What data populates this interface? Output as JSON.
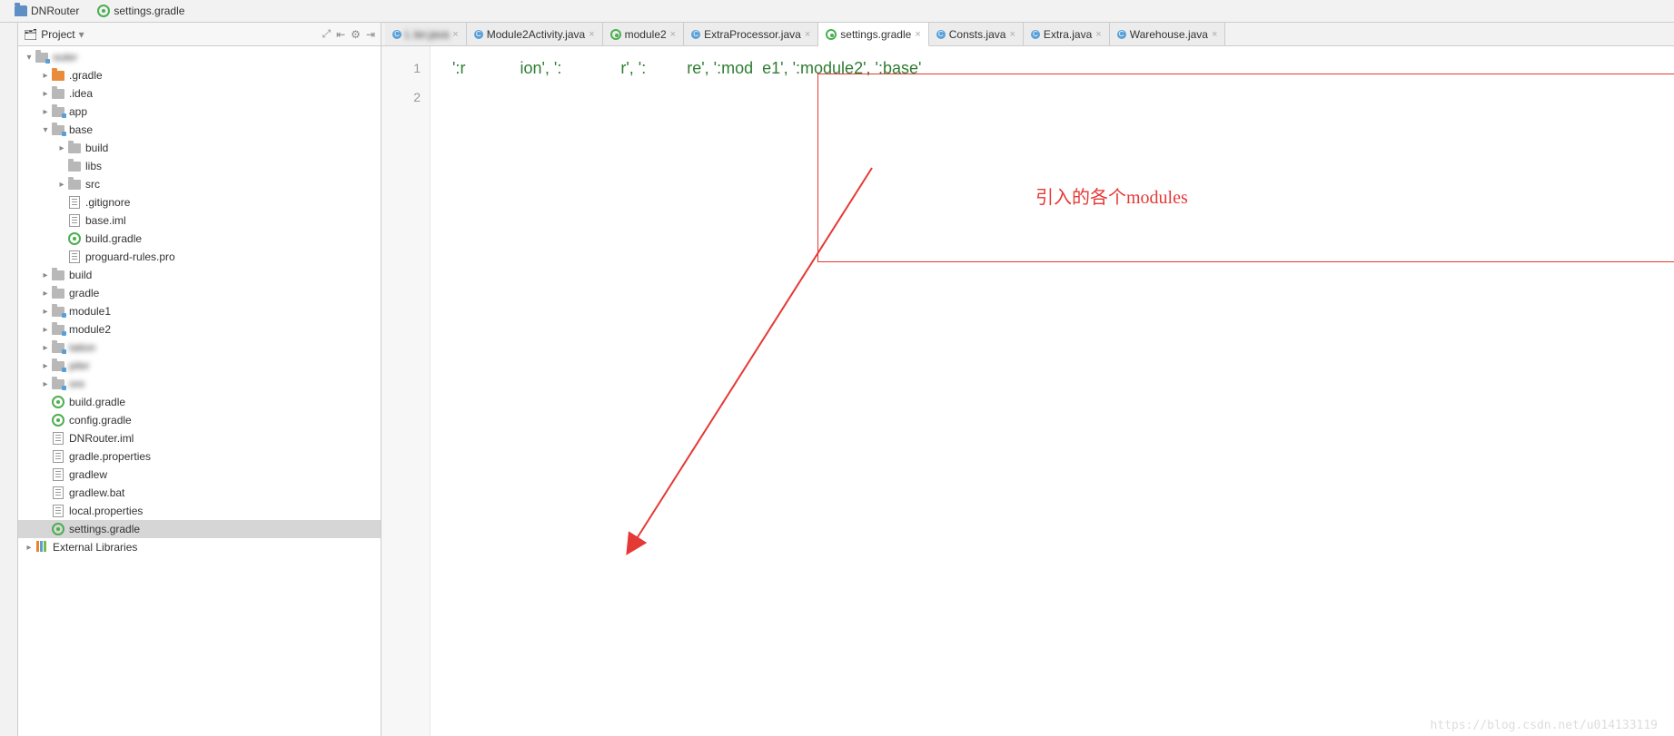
{
  "breadcrumb": {
    "project": "DNRouter",
    "file": "settings.gradle"
  },
  "panel": {
    "title": "Project",
    "tree": [
      {
        "depth": 0,
        "arrow": "down",
        "icon": "module",
        "label": "outer",
        "blur": true
      },
      {
        "depth": 1,
        "arrow": "right",
        "icon": "folder-orange",
        "label": ".gradle"
      },
      {
        "depth": 1,
        "arrow": "right",
        "icon": "folder-grey",
        "label": ".idea"
      },
      {
        "depth": 1,
        "arrow": "right",
        "icon": "module",
        "label": "app"
      },
      {
        "depth": 1,
        "arrow": "down",
        "icon": "module",
        "label": "base"
      },
      {
        "depth": 2,
        "arrow": "right",
        "icon": "folder-grey",
        "label": "build"
      },
      {
        "depth": 2,
        "arrow": "none",
        "icon": "folder-grey",
        "label": "libs"
      },
      {
        "depth": 2,
        "arrow": "right",
        "icon": "folder-grey",
        "label": "src"
      },
      {
        "depth": 2,
        "arrow": "none",
        "icon": "file",
        "label": ".gitignore"
      },
      {
        "depth": 2,
        "arrow": "none",
        "icon": "file",
        "label": "base.iml"
      },
      {
        "depth": 2,
        "arrow": "none",
        "icon": "gradle",
        "label": "build.gradle"
      },
      {
        "depth": 2,
        "arrow": "none",
        "icon": "file",
        "label": "proguard-rules.pro"
      },
      {
        "depth": 1,
        "arrow": "right",
        "icon": "folder-grey",
        "label": "build"
      },
      {
        "depth": 1,
        "arrow": "right",
        "icon": "folder-grey",
        "label": "gradle"
      },
      {
        "depth": 1,
        "arrow": "right",
        "icon": "module",
        "label": "module1"
      },
      {
        "depth": 1,
        "arrow": "right",
        "icon": "module",
        "label": "module2"
      },
      {
        "depth": 1,
        "arrow": "right",
        "icon": "module",
        "label": "tation",
        "blur": true
      },
      {
        "depth": 1,
        "arrow": "right",
        "icon": "module",
        "label": "piler",
        "blur": true
      },
      {
        "depth": 1,
        "arrow": "right",
        "icon": "module",
        "label": "ore",
        "blur": true
      },
      {
        "depth": 1,
        "arrow": "none",
        "icon": "gradle",
        "label": "build.gradle"
      },
      {
        "depth": 1,
        "arrow": "none",
        "icon": "gradle",
        "label": "config.gradle"
      },
      {
        "depth": 1,
        "arrow": "none",
        "icon": "file",
        "label": "DNRouter.iml"
      },
      {
        "depth": 1,
        "arrow": "none",
        "icon": "file",
        "label": "gradle.properties"
      },
      {
        "depth": 1,
        "arrow": "none",
        "icon": "file",
        "label": "gradlew"
      },
      {
        "depth": 1,
        "arrow": "none",
        "icon": "file",
        "label": "gradlew.bat"
      },
      {
        "depth": 1,
        "arrow": "none",
        "icon": "file",
        "label": "local.properties"
      },
      {
        "depth": 1,
        "arrow": "none",
        "icon": "gradle",
        "label": "settings.gradle",
        "selected": true
      },
      {
        "depth": 0,
        "arrow": "right",
        "icon": "lib",
        "label": "External Libraries"
      }
    ]
  },
  "tabs": [
    {
      "icon": "java",
      "label": "L       ter.java",
      "blur": true
    },
    {
      "icon": "java",
      "label": "Module2Activity.java"
    },
    {
      "icon": "gradle",
      "label": "module2"
    },
    {
      "icon": "java",
      "label": "ExtraProcessor.java"
    },
    {
      "icon": "gradle",
      "label": "settings.gradle",
      "active": true
    },
    {
      "icon": "java",
      "label": "Consts.java"
    },
    {
      "icon": "java",
      "label": "Extra.java"
    },
    {
      "icon": "java",
      "label": "Warehouse.java"
    }
  ],
  "code": {
    "line1": "':r            ion', ':             r', ':         re', ':mod  e1', ':module2', ':base'",
    "line2": ""
  },
  "gutter": {
    "l1": "1",
    "l2": "2"
  },
  "annotation": "引入的各个modules",
  "watermark": "https://blog.csdn.net/u014133119"
}
